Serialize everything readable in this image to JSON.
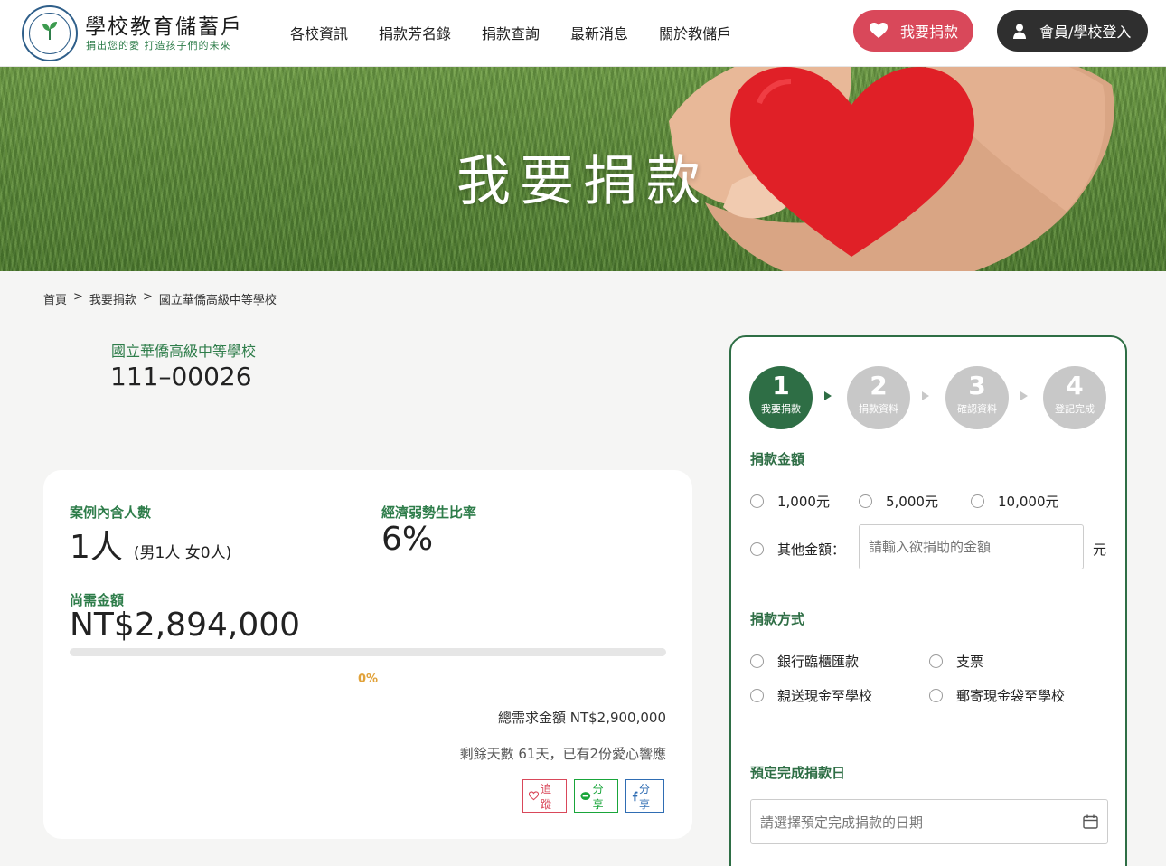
{
  "header": {
    "logo_seal_text": "MINISTRY OF EDUCATION 教育部",
    "site_title": "學校教育儲蓄戶",
    "slogan": "捐出您的愛 打造孩子們的未來",
    "nav": [
      {
        "label": "各校資訊"
      },
      {
        "label": "捐款芳名錄"
      },
      {
        "label": "捐款查詢"
      },
      {
        "label": "最新消息"
      },
      {
        "label": "關於教儲戶"
      }
    ],
    "donate_button": "我要捐款",
    "login_button": "會員/學校登入",
    "colors": {
      "donate": "#d9485a",
      "login": "#2f2f2f",
      "brand_green": "#2e6e45"
    }
  },
  "banner": {
    "title": "我要捐款"
  },
  "breadcrumb": {
    "items": [
      "首頁",
      "我要捐款",
      "國立華僑高級中等學校"
    ],
    "separator": ">"
  },
  "school": {
    "name": "國立華僑高級中等學校",
    "case_id": "111–00026"
  },
  "stats": {
    "people_label": "案例內含人數",
    "people_value": "1人",
    "people_detail": "(男1人 女0人)",
    "ratio_label": "經濟弱勢生比率",
    "ratio_value": "6%",
    "needed_label": "尚需金額",
    "needed_value": "NT$2,894,000",
    "progress_fraction": 0.0,
    "progress_text": "0%",
    "total_text": "總需求金額 NT$2,900,000",
    "days_text": "剩餘天數 61天，已有2份愛心響應",
    "share": {
      "track": "追蹤",
      "line": "分享",
      "fb": "分享"
    }
  },
  "form": {
    "steps": [
      {
        "num": "1",
        "label": "我要捐款",
        "active": true
      },
      {
        "num": "2",
        "label": "捐款資料",
        "active": false
      },
      {
        "num": "3",
        "label": "確認資料",
        "active": false
      },
      {
        "num": "4",
        "label": "登記完成",
        "active": false
      }
    ],
    "amount_title": "捐款金額",
    "amounts": [
      "1,000元",
      "5,000元",
      "10,000元"
    ],
    "other_label": "其他金額：",
    "other_placeholder": "請輸入欲捐助的金額",
    "unit": "元",
    "method_title": "捐款方式",
    "methods": [
      "銀行臨櫃匯款",
      "支票",
      "親送現金至學校",
      "郵寄現金袋至學校"
    ],
    "date_title": "預定完成捐款日",
    "date_placeholder": "請選擇預定完成捐款的日期"
  }
}
